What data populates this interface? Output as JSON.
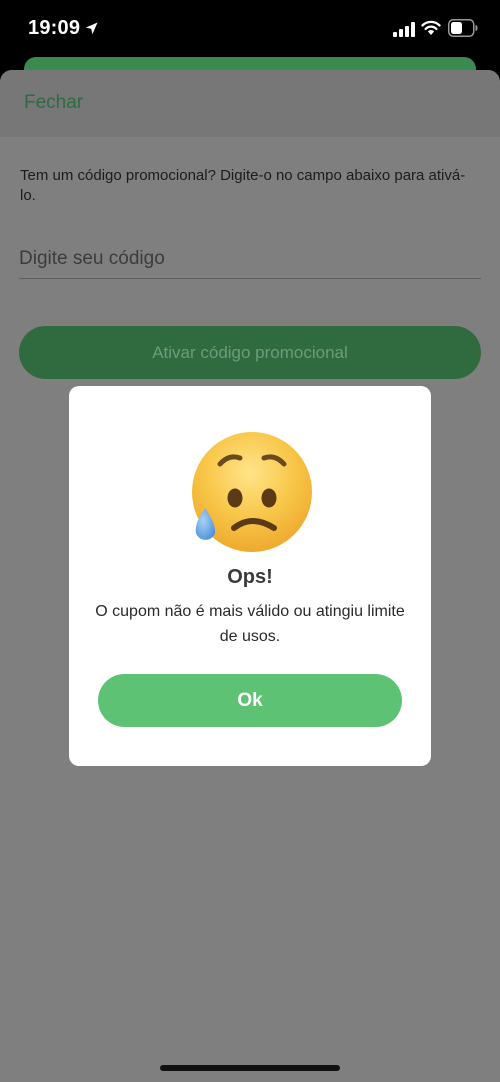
{
  "status_bar": {
    "time": "19:09",
    "icons": [
      "location-arrow-icon",
      "cellular-signal-icon",
      "wifi-icon",
      "battery-icon"
    ]
  },
  "sheet": {
    "close_label": "Fechar",
    "instructions": "Tem um código promocional? Digite-o no campo abaixo para ativá-lo.",
    "code_input": {
      "placeholder": "Digite seu código",
      "value": ""
    },
    "activate_label": "Ativar código promocional"
  },
  "dialog": {
    "icon": "sad-face-icon",
    "title": "Ops!",
    "message": "O cupom não é mais válido ou atingiu limite de usos.",
    "ok_label": "Ok"
  },
  "colors": {
    "accent_green": "#5ec275",
    "overlay_gray": "#7f7f7f",
    "dialog_background": "#ffffff"
  }
}
